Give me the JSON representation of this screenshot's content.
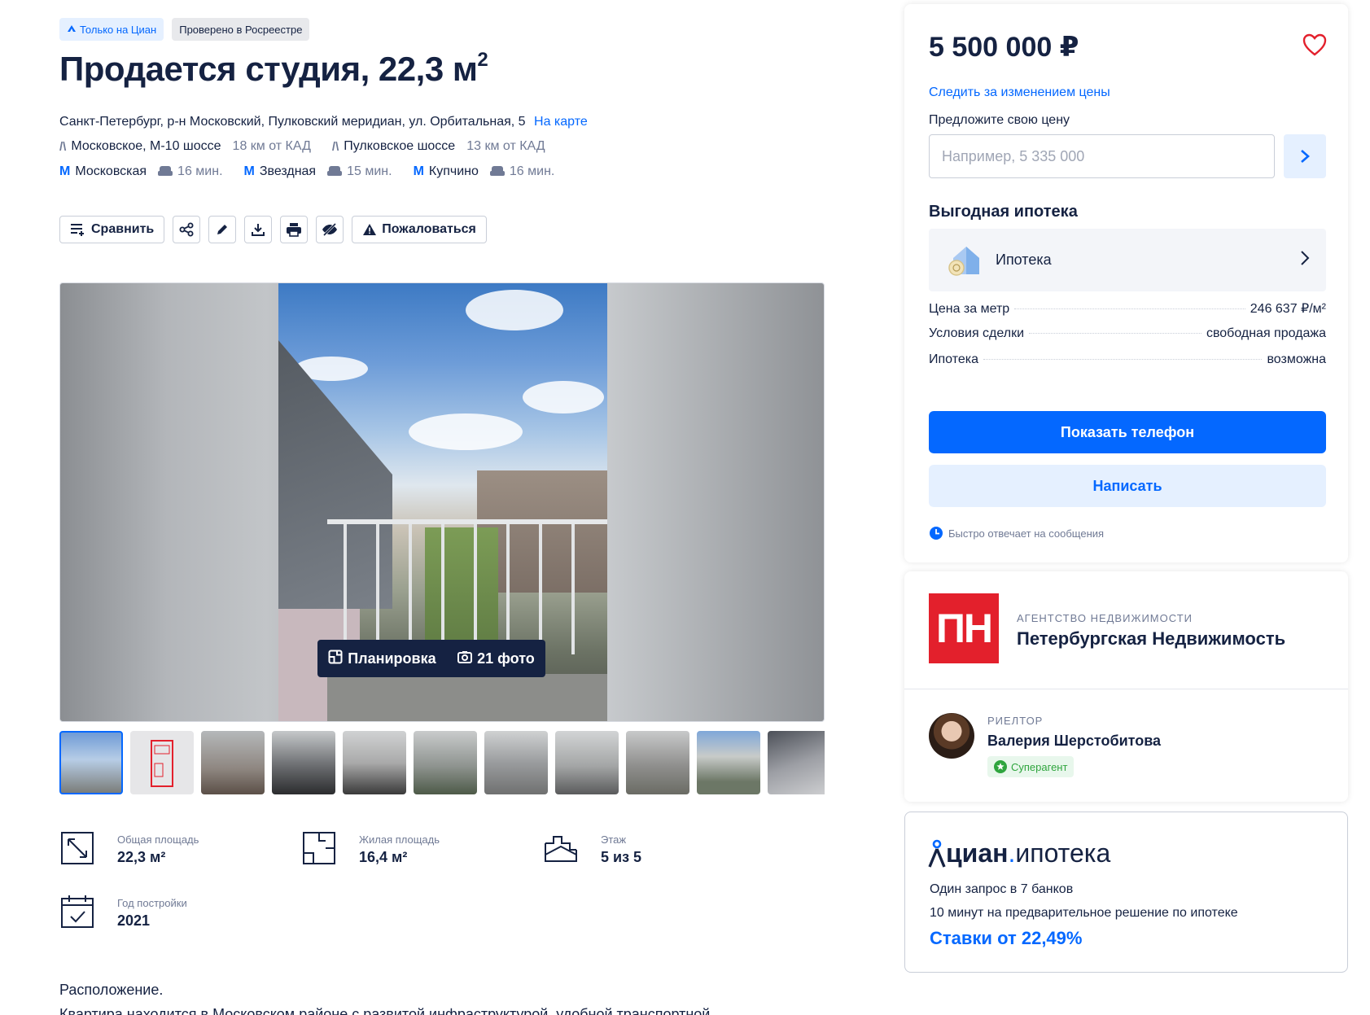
{
  "badges": {
    "only_cian": "Только на Циан",
    "verified": "Проверено в Росреестре"
  },
  "listing": {
    "title": "Продается студия, 22,3 м",
    "title_sup": "2",
    "address": "Санкт-Петербург, р-н Московский, Пулковский меридиан, ул. Орбитальная, 5",
    "map_link": "На карте"
  },
  "highways": [
    {
      "name": "Московское, М-10 шоссе",
      "distance": "18 км от КАД"
    },
    {
      "name": "Пулковское шоссе",
      "distance": "13 км от КАД"
    }
  ],
  "metro": [
    {
      "name": "Московская",
      "time": "16 мин."
    },
    {
      "name": "Звездная",
      "time": "15 мин."
    },
    {
      "name": "Купчино",
      "time": "16 мин."
    }
  ],
  "toolbar": {
    "compare": "Сравнить",
    "report": "Пожаловаться"
  },
  "gallery": {
    "layout_label": "Планировка",
    "photos_label": "21 фото"
  },
  "facts": {
    "total_area": {
      "label": "Общая площадь",
      "value": "22,3 м²"
    },
    "living_area": {
      "label": "Жилая площадь",
      "value": "16,4 м²"
    },
    "floor": {
      "label": "Этаж",
      "value": "5 из 5"
    },
    "year": {
      "label": "Год постройки",
      "value": "2021"
    }
  },
  "description": {
    "line1": "Расположение.",
    "line2": "Квартира находится в Московском районе с развитой инфраструктурой, удобной транспортной"
  },
  "sidebar": {
    "price": "5 500 000 ₽",
    "watch_price": "Следить за изменением цены",
    "offer_label": "Предложите свою цену",
    "offer_placeholder": "Например, 5 335 000",
    "mortgage_title": "Выгодная ипотека",
    "mortgage_item": "Ипотека",
    "details": [
      {
        "key": "Цена за метр",
        "value": "246 637 ₽/м²"
      },
      {
        "key": "Условия сделки",
        "value": "свободная продажа"
      },
      {
        "key": "Ипотека",
        "value": "возможна"
      }
    ],
    "show_phone": "Показать телефон",
    "write": "Написать",
    "fast_reply": "Быстро отвечает на сообщения"
  },
  "agency": {
    "logo": "ПН",
    "type": "АГЕНТСТВО НЕДВИЖИМОСТИ",
    "name": "Петербургская Недвижимость",
    "realtor_type": "РИЕЛТОР",
    "realtor_name": "Валерия Шерстобитова",
    "realtor_badge": "Суперагент"
  },
  "cian_mortgage": {
    "logo_word": "циан",
    "logo_dot": ".",
    "logo_suffix": "ипотека",
    "line1": "Один запрос в 7 банков",
    "line2": "10 минут на предварительное решение по ипотеке",
    "rate": "Ставки от 22,49%"
  },
  "colors": {
    "accent": "#0468ff",
    "text": "#152242",
    "muted": "#707a95",
    "agency_red": "#e3202c"
  }
}
